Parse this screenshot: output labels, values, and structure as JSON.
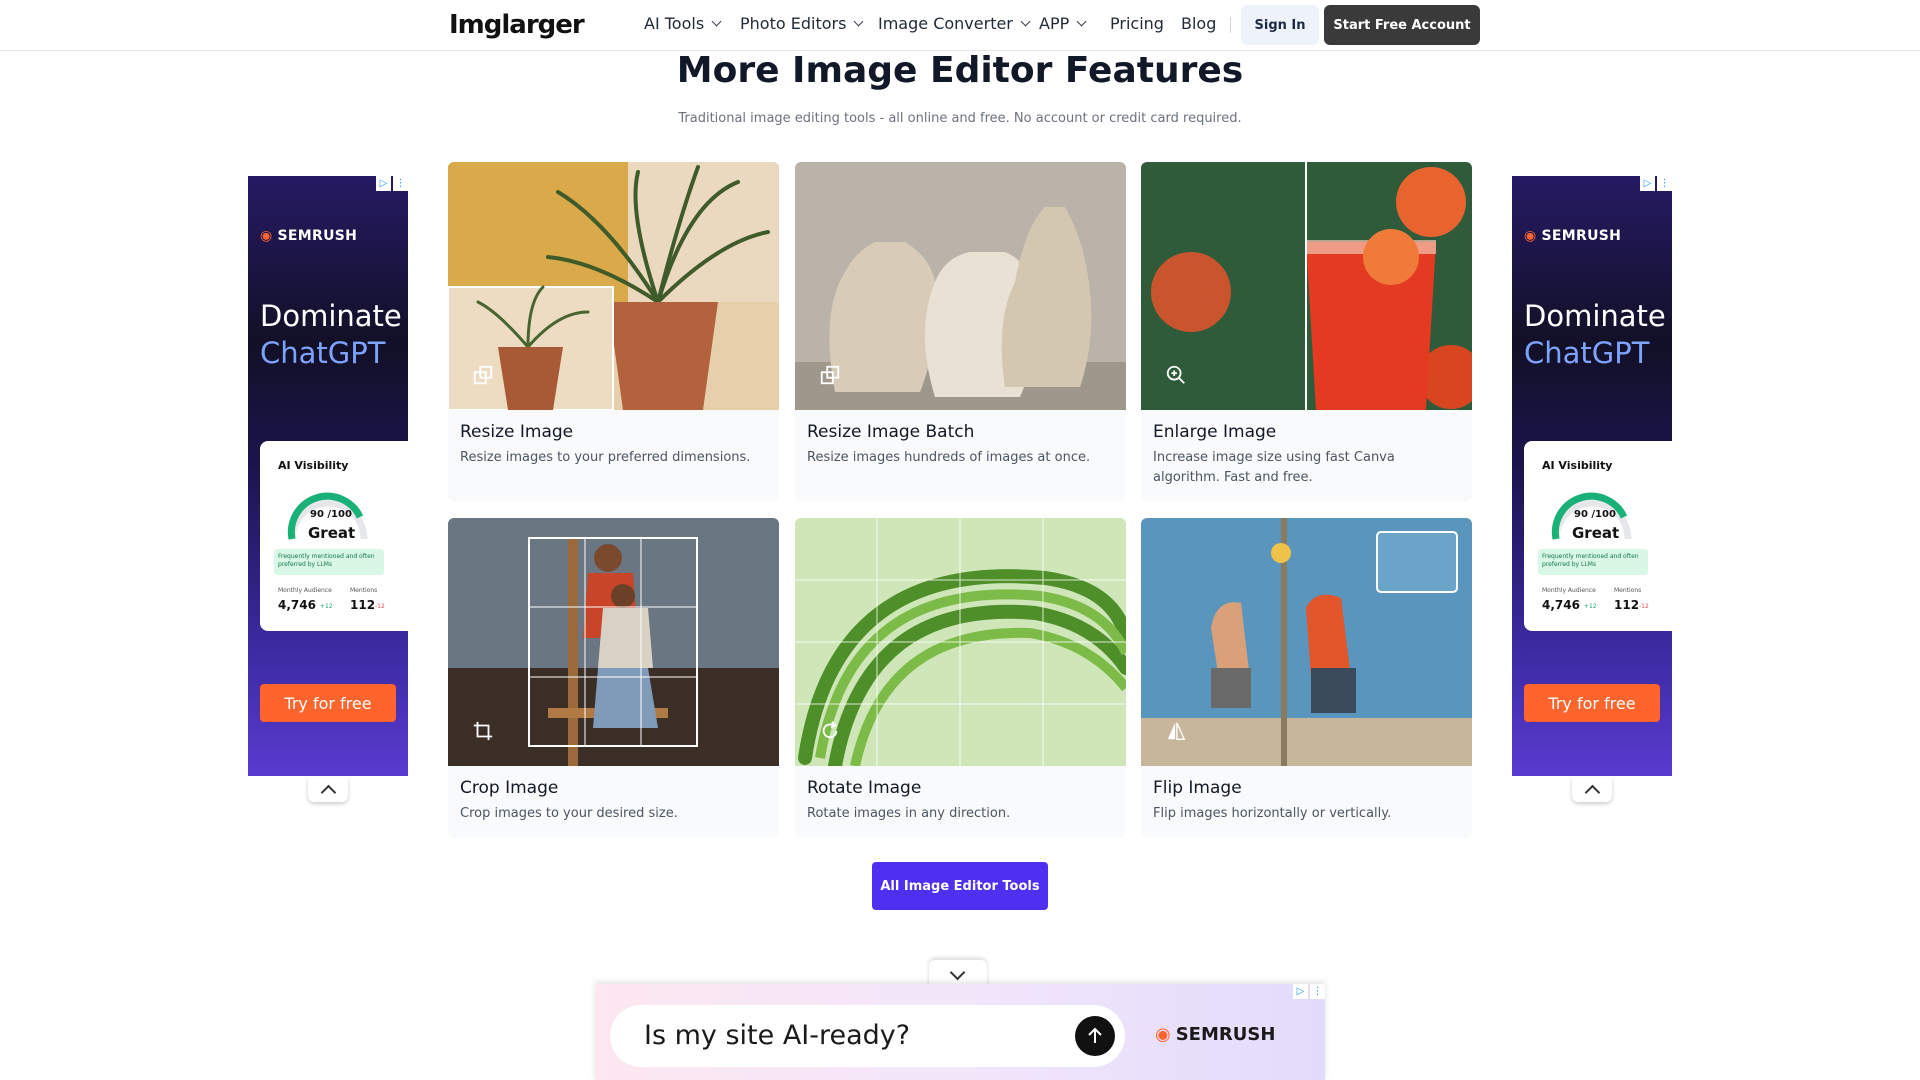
{
  "nav": {
    "logo": "Imglarger",
    "items": [
      "AI Tools",
      "Photo Editors",
      "Image Converter",
      "APP",
      "Pricing",
      "Blog"
    ],
    "signin": "Sign In",
    "start": "Start Free Account"
  },
  "section": {
    "title": "More Image Editor Features",
    "subtitle": "Traditional image editing tools - all online and free. No account or credit card required."
  },
  "cards": [
    {
      "title": "Resize Image",
      "desc": "Resize images to your preferred dimensions.",
      "icon": "resize-icon"
    },
    {
      "title": "Resize Image Batch",
      "desc": "Resize images hundreds of images at once.",
      "icon": "resize-icon"
    },
    {
      "title": "Enlarge Image",
      "desc": "Increase image size using fast Canva algorithm. Fast and free.",
      "icon": "zoom-in-icon"
    },
    {
      "title": "Crop Image",
      "desc": "Crop images to your desired size.",
      "icon": "crop-icon"
    },
    {
      "title": "Rotate Image",
      "desc": "Rotate images in any direction.",
      "icon": "rotate-icon"
    },
    {
      "title": "Flip Image",
      "desc": "Flip images horizontally or vertically.",
      "icon": "flip-icon"
    }
  ],
  "cta": "All Image Editor Tools",
  "side_ad": {
    "brand": "SEMRUSH",
    "headline1": "Dominate",
    "headline2": "ChatGPT",
    "panel_title": "AI Visibility",
    "score": "90 /100",
    "rating": "Great",
    "note": "Frequently mentioned and often preferred by LLMs",
    "label1": "Monthly Audience",
    "value1": "4,746",
    "delta1": "+12",
    "label2": "Mentions",
    "value2": "112",
    "delta2": "-12",
    "cta": "Try for free"
  },
  "bottom_ad": {
    "question": "Is my site AI-ready?",
    "brand": "SEMRUSH"
  },
  "colors": {
    "accent": "#4f2ff0",
    "ad_orange": "#ff642d",
    "ad_blue": "#7da2ff"
  }
}
